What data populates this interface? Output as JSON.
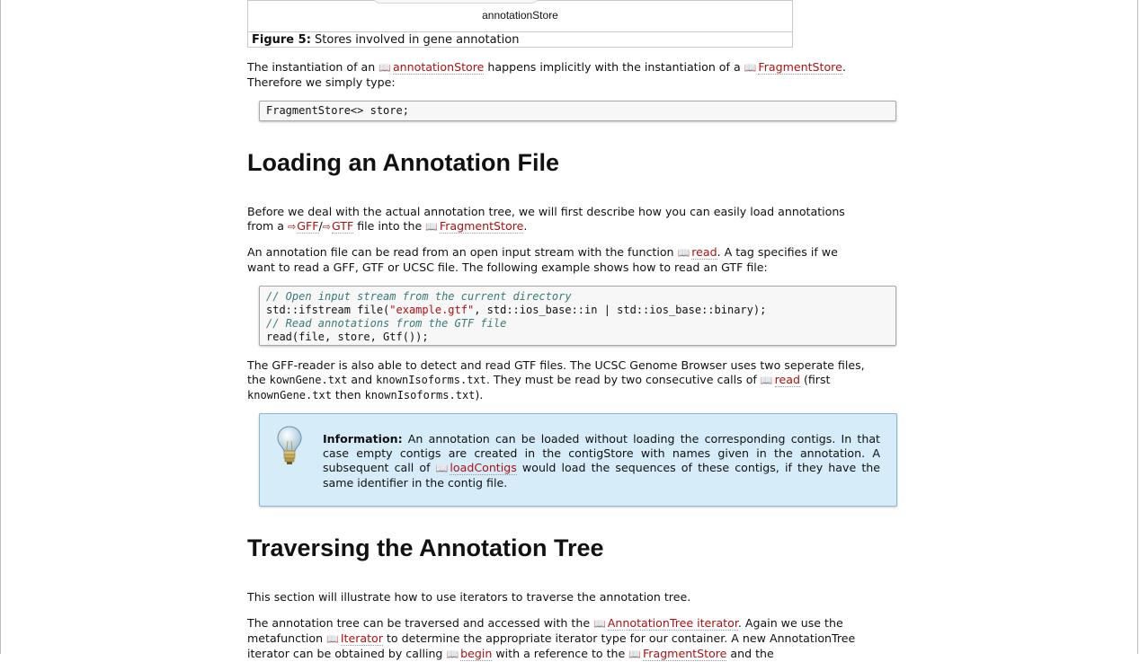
{
  "figure": {
    "store_label": "annotationStore",
    "caption_label": "Figure 5:",
    "caption_text": " Stores involved in gene annotation"
  },
  "para1": {
    "t1": "The instantiation of an ",
    "link1": "annotationStore",
    "t2": " happens implicitly with the instantiation of a ",
    "link2": "FragmentStore",
    "t3": ".",
    "t4": "Therefore we simply type:"
  },
  "code1": "FragmentStore<> store;",
  "heading1": "Loading an Annotation File",
  "para2": {
    "t1": "Before we deal with the actual annotation tree, we will first describe how you can easily load annotations",
    "t2": "from a ",
    "link1": "GFF",
    "sep": "/",
    "link2": "GTF",
    "t3": " file into the ",
    "link3": "FragmentStore",
    "t4": "."
  },
  "para3": {
    "t1": "An annotation file can be read from an open input stream with the function ",
    "link1": "read",
    "t2": ". A tag specifies if we",
    "t3": "want to read a GFF, GTF or UCSC file. The following example shows how to read an GTF file:"
  },
  "code2": {
    "line1": "// Open input stream from the current directory",
    "line2a": "std::ifstream file(",
    "line2b": "\"example.gtf\"",
    "line2c": ", std::ios_base::in | std::ios_base::binary);",
    "line3": "// Read annotations from the GTF file",
    "line4": "read(file, store, Gtf());"
  },
  "para4": {
    "t1": "The GFF-reader is also able to detect and read GTF files. The UCSC Genome Browser uses two seperate files,",
    "t2": "the ",
    "c1": "kownGene.txt",
    "t3": " and ",
    "c2": "knownIsoforms.txt",
    "t4": ". They must be read by two consecutive calls of ",
    "link1": "read",
    "t5": " (first",
    "c3": "knownGene.txt",
    "t6": " then ",
    "c4": "knownIsoforms.txt",
    "t7": ")."
  },
  "info": {
    "label": "Information:",
    "t1": " An annotation can be loaded without loading the corresponding contigs. In that case empty contigs are created in the contigStore with names given in the annotation. A subsequent call of ",
    "link1": "loadContigs",
    "t2": " would load the sequences of these contigs, if they have the same identifier in the contig file."
  },
  "heading2": "Traversing the Annotation Tree",
  "para5": "This section will illustrate how to use iterators to traverse the annotation tree.",
  "para6": {
    "t1": "The annotation tree can be traversed and accessed with the ",
    "link1": "AnnotationTree iterator",
    "t2": ". Again we use the",
    "t3": "metafunction ",
    "link2": "Iterator",
    "t4": " to determine the appropriate iterator type for our container. A new AnnotationTree",
    "t5": "iterator can be obtained by calling ",
    "link3": "begin",
    "t6": " with a reference to the ",
    "link4": "FragmentStore",
    "t7": " and the"
  },
  "icons": {
    "book": "book-icon",
    "arrow": "external-arrow-icon",
    "bulb": "lightbulb-icon"
  },
  "colors": {
    "link": "#b01010",
    "info_bg": "#d7ecf9",
    "code_bg": "#f7f7f7",
    "comment": "#3a7a7a"
  }
}
